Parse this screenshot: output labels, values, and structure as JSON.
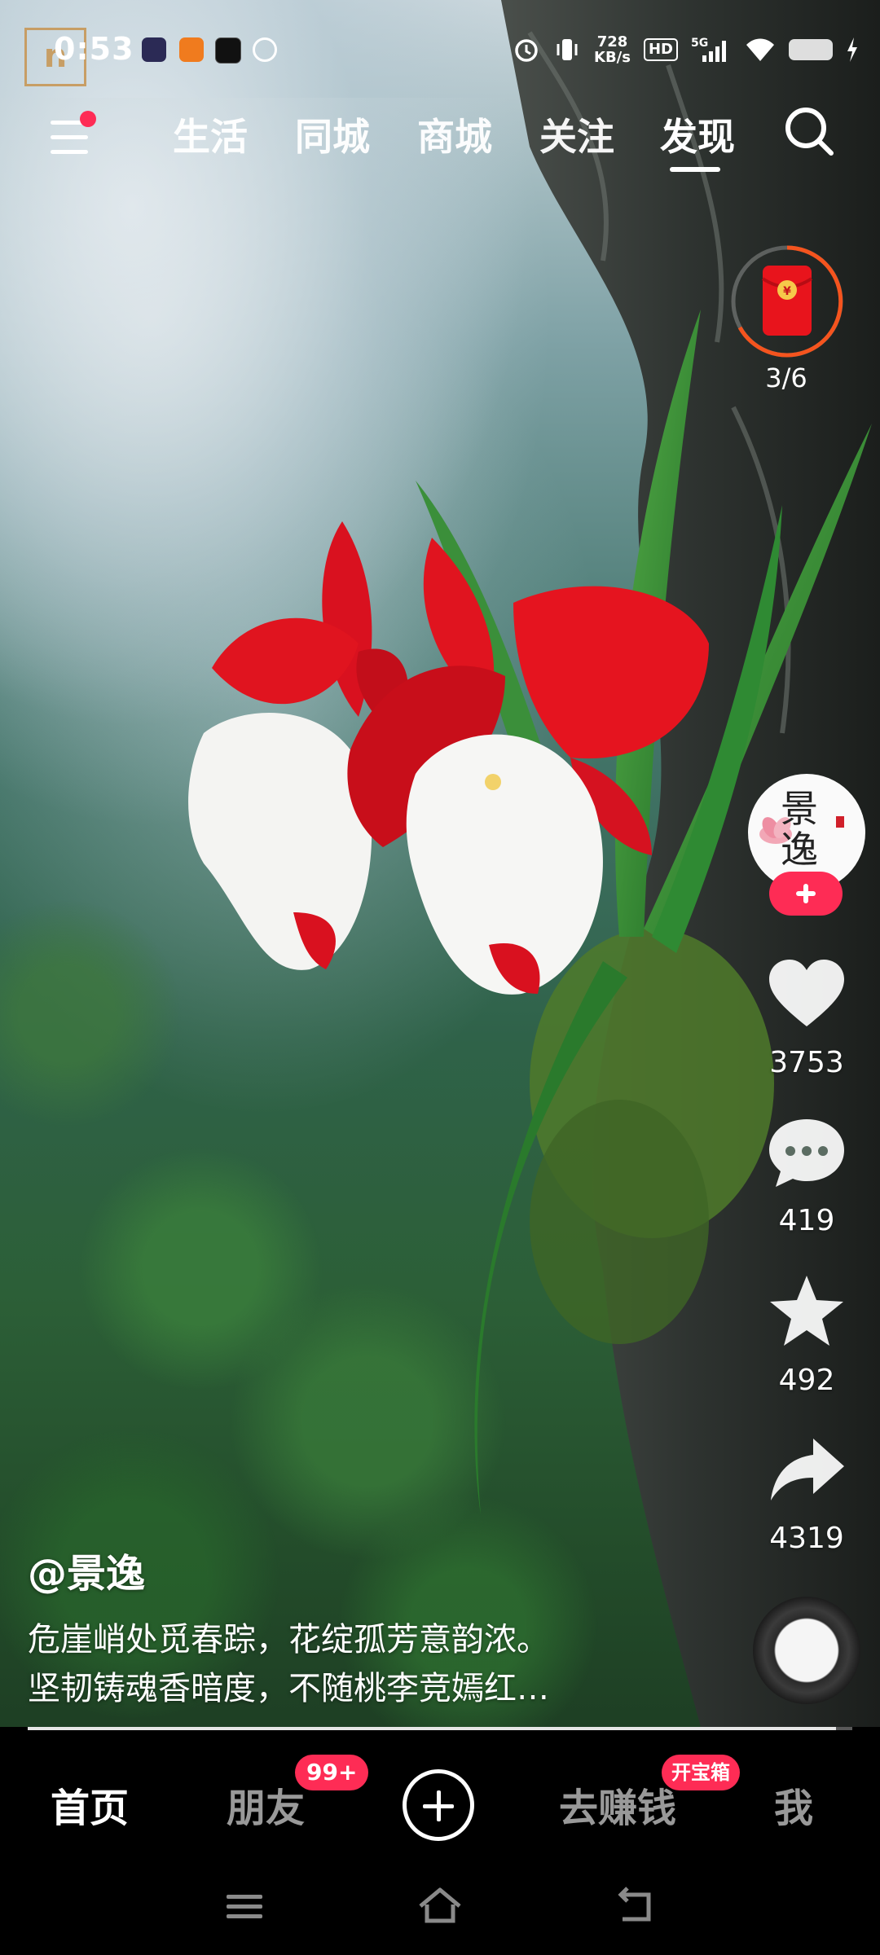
{
  "status_bar": {
    "time": "0:53",
    "net_speed_value": "728",
    "net_speed_unit": "KB/s",
    "hd_label": "HD",
    "network": "5G"
  },
  "top_nav": {
    "tabs": [
      "生活",
      "同城",
      "商城",
      "关注",
      "发现"
    ],
    "active_tab": "发现"
  },
  "red_packet": {
    "progress": "3/6"
  },
  "creator": {
    "avatar_text": "景逸",
    "handle": "@景逸"
  },
  "actions": {
    "likes": "3753",
    "comments": "419",
    "favorites": "492",
    "shares": "4319"
  },
  "caption": {
    "line1": "危崖峭处觅春踪，花绽孤芳意韵浓。",
    "line2": "坚韧铸魂香暗度，不随桃李竞嫣红…"
  },
  "playback": {
    "progress_fraction": 0.98
  },
  "bottom_nav": {
    "home": "首页",
    "friends": "朋友",
    "friends_badge": "99+",
    "earn": "去赚钱",
    "earn_badge": "开宝箱",
    "me": "我"
  },
  "colors": {
    "accent": "#fe2c55",
    "red_packet_ring": "#f5541e"
  },
  "icons": [
    "menu-icon",
    "search-icon",
    "red-envelope-icon",
    "heart-icon",
    "comment-icon",
    "star-icon",
    "share-icon",
    "music-disc-icon",
    "plus-icon",
    "system-menu-icon",
    "system-home-icon",
    "system-back-icon"
  ]
}
